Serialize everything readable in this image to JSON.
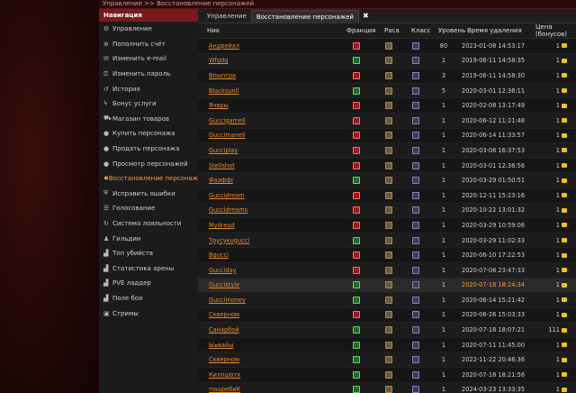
{
  "breadcrumb": "Управление >> Восстановление персонажей",
  "sidebar": {
    "header": "Навигация",
    "items": [
      {
        "label": "Управление",
        "icon": "gear-icon",
        "glyph": "⚙"
      },
      {
        "label": "Пополнить счёт",
        "icon": "plus-icon",
        "glyph": "⊕"
      },
      {
        "label": "Изменить e-mail",
        "icon": "mail-icon",
        "glyph": "✉"
      },
      {
        "label": "Изменить пароль",
        "icon": "key-icon",
        "glyph": "⚿"
      },
      {
        "label": "История",
        "icon": "history-icon",
        "glyph": "↺"
      },
      {
        "label": "Бонус услуги",
        "icon": "bolt-icon",
        "glyph": "ϟ"
      },
      {
        "label": "Магазин товаров",
        "icon": "cart-icon",
        "glyph": "⛟"
      },
      {
        "label": "Купить персонажа",
        "icon": "user-icon",
        "glyph": "●"
      },
      {
        "label": "Продать персонажа",
        "icon": "user-icon",
        "glyph": "●"
      },
      {
        "label": "Просмотр персонажей",
        "icon": "user-icon",
        "glyph": "●"
      },
      {
        "label": "Восстановление персонажей",
        "icon": "revive-icon",
        "glyph": "✸",
        "active": true
      },
      {
        "label": "Исправить ошибки",
        "icon": "shield-icon",
        "glyph": "⛨"
      },
      {
        "label": "Голосование",
        "icon": "vote-icon",
        "glyph": "☰"
      },
      {
        "label": "Система лояльности",
        "icon": "loyalty-icon",
        "glyph": "↻"
      },
      {
        "label": "Гильдии",
        "icon": "guild-icon",
        "glyph": "♟"
      },
      {
        "label": "Топ убийств",
        "icon": "chart-icon",
        "glyph": "▟"
      },
      {
        "label": "Статистика арены",
        "icon": "chart-icon",
        "glyph": "▟"
      },
      {
        "label": "PVE ладдер",
        "icon": "chart-icon",
        "glyph": "▟"
      },
      {
        "label": "Поле боя",
        "icon": "chart-icon",
        "glyph": "▟"
      },
      {
        "label": "Стримы",
        "icon": "stream-icon",
        "glyph": "▣"
      }
    ]
  },
  "tabs": [
    {
      "label": "Управление",
      "active": false
    },
    {
      "label": "Восстановление персонажей",
      "active": true
    }
  ],
  "table": {
    "headers": [
      "Ник",
      "Фракция",
      "Раса",
      "Класс",
      "Уровень",
      "Время удаления",
      "Цена (бонусов)"
    ],
    "rows": [
      {
        "name": "Андрейхл",
        "faction": "horde",
        "level": "80",
        "deleted": "2023-01-08 14:53:17",
        "price": "1"
      },
      {
        "name": "Wfgdg",
        "faction": "alliance",
        "level": "1",
        "deleted": "2019-06-11 14:58:35",
        "price": "1"
      },
      {
        "name": "Впыпгра",
        "faction": "horde",
        "level": "3",
        "deleted": "2019-06-11 14:58:30",
        "price": "1"
      },
      {
        "name": "Blacksunll",
        "faction": "alliance",
        "level": "5",
        "deleted": "2020-03-01 12:36:11",
        "price": "1"
      },
      {
        "name": "Ячвры",
        "faction": "horde",
        "level": "1",
        "deleted": "2020-02-08 13:17:49",
        "price": "1"
      },
      {
        "name": "Guccigamell",
        "faction": "horde",
        "level": "1",
        "deleted": "2020-06-12 11:21:48",
        "price": "1"
      },
      {
        "name": "Guccimanell",
        "faction": "horde",
        "level": "1",
        "deleted": "2020-06-14 11:33:57",
        "price": "1"
      },
      {
        "name": "Gucciplay",
        "faction": "horde",
        "level": "1",
        "deleted": "2020-03-08 16:37:53",
        "price": "1"
      },
      {
        "name": "Stellshot",
        "faction": "horde",
        "level": "1",
        "deleted": "2020-03-01 12:36:56",
        "price": "1"
      },
      {
        "name": "Фааффі",
        "faction": "alliance",
        "level": "1",
        "deleted": "2020-03-29 01:50:51",
        "price": "1"
      },
      {
        "name": "Guccidream",
        "faction": "horde",
        "level": "1",
        "deleted": "2020-12-11 15:23:16",
        "price": "1"
      },
      {
        "name": "Guccidreams",
        "faction": "horde",
        "level": "1",
        "deleted": "2020-10-22 13:01:32",
        "price": "1"
      },
      {
        "name": "Mydread",
        "faction": "horde",
        "level": "1",
        "deleted": "2020-03-29 10:59:06",
        "price": "1"
      },
      {
        "name": "Трусукugucci",
        "faction": "alliance",
        "level": "1",
        "deleted": "2020-03-29 11:02:33",
        "price": "1"
      },
      {
        "name": "Bgucci",
        "faction": "horde",
        "level": "1",
        "deleted": "2020-06-10 17:22:53",
        "price": "1"
      },
      {
        "name": "Gucciday",
        "faction": "horde",
        "level": "1",
        "deleted": "2020-07-08 23:47:33",
        "price": "1"
      },
      {
        "name": "Guccistyle",
        "faction": "alliance",
        "level": "1",
        "deleted": "2020-07-18 18:24:34",
        "price": "1",
        "highlight": true
      },
      {
        "name": "Guccimoney",
        "faction": "alliance",
        "level": "1",
        "deleted": "2020-06-14 15:21:42",
        "price": "1"
      },
      {
        "name": "Скверном",
        "faction": "horde",
        "level": "1",
        "deleted": "2020-06-26 15:03:33",
        "price": "1"
      },
      {
        "name": "Санарбой",
        "faction": "alliance",
        "level": "1",
        "deleted": "2020-07-18 18:07:21",
        "price": "111"
      },
      {
        "name": "Ы๑вайы",
        "faction": "alliance",
        "level": "1",
        "deleted": "2020-07-11 11:45:00",
        "price": "1"
      },
      {
        "name": "Скверном",
        "faction": "alliance",
        "level": "1",
        "deleted": "2022-11-22 20:46:36",
        "price": "1"
      },
      {
        "name": "Киллшотх",
        "faction": "alliance",
        "level": "1",
        "deleted": "2020-07-18 18:21:56",
        "price": "1"
      },
      {
        "name": "тошребиК",
        "faction": "alliance",
        "level": "1",
        "deleted": "2024-03-23 13:33:35",
        "price": "1"
      }
    ]
  }
}
